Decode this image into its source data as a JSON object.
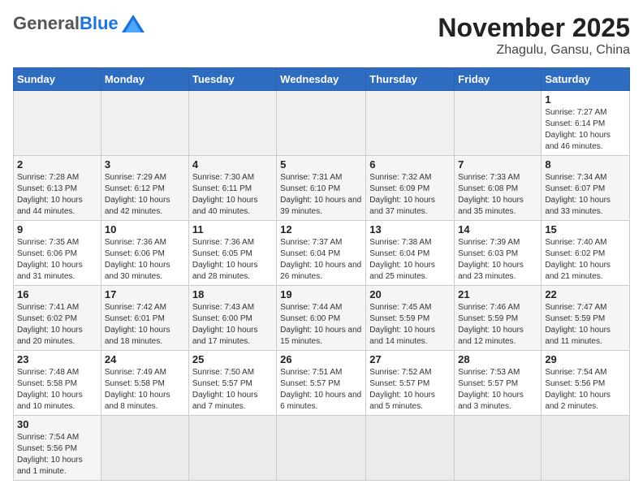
{
  "header": {
    "logo_general": "General",
    "logo_blue": "Blue",
    "month_title": "November 2025",
    "subtitle": "Zhagulu, Gansu, China"
  },
  "weekdays": [
    "Sunday",
    "Monday",
    "Tuesday",
    "Wednesday",
    "Thursday",
    "Friday",
    "Saturday"
  ],
  "weeks": [
    [
      {
        "day": "",
        "info": ""
      },
      {
        "day": "",
        "info": ""
      },
      {
        "day": "",
        "info": ""
      },
      {
        "day": "",
        "info": ""
      },
      {
        "day": "",
        "info": ""
      },
      {
        "day": "",
        "info": ""
      },
      {
        "day": "1",
        "info": "Sunrise: 7:27 AM\nSunset: 6:14 PM\nDaylight: 10 hours and 46 minutes."
      }
    ],
    [
      {
        "day": "2",
        "info": "Sunrise: 7:28 AM\nSunset: 6:13 PM\nDaylight: 10 hours and 44 minutes."
      },
      {
        "day": "3",
        "info": "Sunrise: 7:29 AM\nSunset: 6:12 PM\nDaylight: 10 hours and 42 minutes."
      },
      {
        "day": "4",
        "info": "Sunrise: 7:30 AM\nSunset: 6:11 PM\nDaylight: 10 hours and 40 minutes."
      },
      {
        "day": "5",
        "info": "Sunrise: 7:31 AM\nSunset: 6:10 PM\nDaylight: 10 hours and 39 minutes."
      },
      {
        "day": "6",
        "info": "Sunrise: 7:32 AM\nSunset: 6:09 PM\nDaylight: 10 hours and 37 minutes."
      },
      {
        "day": "7",
        "info": "Sunrise: 7:33 AM\nSunset: 6:08 PM\nDaylight: 10 hours and 35 minutes."
      },
      {
        "day": "8",
        "info": "Sunrise: 7:34 AM\nSunset: 6:07 PM\nDaylight: 10 hours and 33 minutes."
      }
    ],
    [
      {
        "day": "9",
        "info": "Sunrise: 7:35 AM\nSunset: 6:06 PM\nDaylight: 10 hours and 31 minutes."
      },
      {
        "day": "10",
        "info": "Sunrise: 7:36 AM\nSunset: 6:06 PM\nDaylight: 10 hours and 30 minutes."
      },
      {
        "day": "11",
        "info": "Sunrise: 7:36 AM\nSunset: 6:05 PM\nDaylight: 10 hours and 28 minutes."
      },
      {
        "day": "12",
        "info": "Sunrise: 7:37 AM\nSunset: 6:04 PM\nDaylight: 10 hours and 26 minutes."
      },
      {
        "day": "13",
        "info": "Sunrise: 7:38 AM\nSunset: 6:04 PM\nDaylight: 10 hours and 25 minutes."
      },
      {
        "day": "14",
        "info": "Sunrise: 7:39 AM\nSunset: 6:03 PM\nDaylight: 10 hours and 23 minutes."
      },
      {
        "day": "15",
        "info": "Sunrise: 7:40 AM\nSunset: 6:02 PM\nDaylight: 10 hours and 21 minutes."
      }
    ],
    [
      {
        "day": "16",
        "info": "Sunrise: 7:41 AM\nSunset: 6:02 PM\nDaylight: 10 hours and 20 minutes."
      },
      {
        "day": "17",
        "info": "Sunrise: 7:42 AM\nSunset: 6:01 PM\nDaylight: 10 hours and 18 minutes."
      },
      {
        "day": "18",
        "info": "Sunrise: 7:43 AM\nSunset: 6:00 PM\nDaylight: 10 hours and 17 minutes."
      },
      {
        "day": "19",
        "info": "Sunrise: 7:44 AM\nSunset: 6:00 PM\nDaylight: 10 hours and 15 minutes."
      },
      {
        "day": "20",
        "info": "Sunrise: 7:45 AM\nSunset: 5:59 PM\nDaylight: 10 hours and 14 minutes."
      },
      {
        "day": "21",
        "info": "Sunrise: 7:46 AM\nSunset: 5:59 PM\nDaylight: 10 hours and 12 minutes."
      },
      {
        "day": "22",
        "info": "Sunrise: 7:47 AM\nSunset: 5:59 PM\nDaylight: 10 hours and 11 minutes."
      }
    ],
    [
      {
        "day": "23",
        "info": "Sunrise: 7:48 AM\nSunset: 5:58 PM\nDaylight: 10 hours and 10 minutes."
      },
      {
        "day": "24",
        "info": "Sunrise: 7:49 AM\nSunset: 5:58 PM\nDaylight: 10 hours and 8 minutes."
      },
      {
        "day": "25",
        "info": "Sunrise: 7:50 AM\nSunset: 5:57 PM\nDaylight: 10 hours and 7 minutes."
      },
      {
        "day": "26",
        "info": "Sunrise: 7:51 AM\nSunset: 5:57 PM\nDaylight: 10 hours and 6 minutes."
      },
      {
        "day": "27",
        "info": "Sunrise: 7:52 AM\nSunset: 5:57 PM\nDaylight: 10 hours and 5 minutes."
      },
      {
        "day": "28",
        "info": "Sunrise: 7:53 AM\nSunset: 5:57 PM\nDaylight: 10 hours and 3 minutes."
      },
      {
        "day": "29",
        "info": "Sunrise: 7:54 AM\nSunset: 5:56 PM\nDaylight: 10 hours and 2 minutes."
      }
    ],
    [
      {
        "day": "30",
        "info": "Sunrise: 7:54 AM\nSunset: 5:56 PM\nDaylight: 10 hours and 1 minute."
      },
      {
        "day": "",
        "info": ""
      },
      {
        "day": "",
        "info": ""
      },
      {
        "day": "",
        "info": ""
      },
      {
        "day": "",
        "info": ""
      },
      {
        "day": "",
        "info": ""
      },
      {
        "day": "",
        "info": ""
      }
    ]
  ],
  "shaded_rows": [
    1,
    3,
    5
  ]
}
